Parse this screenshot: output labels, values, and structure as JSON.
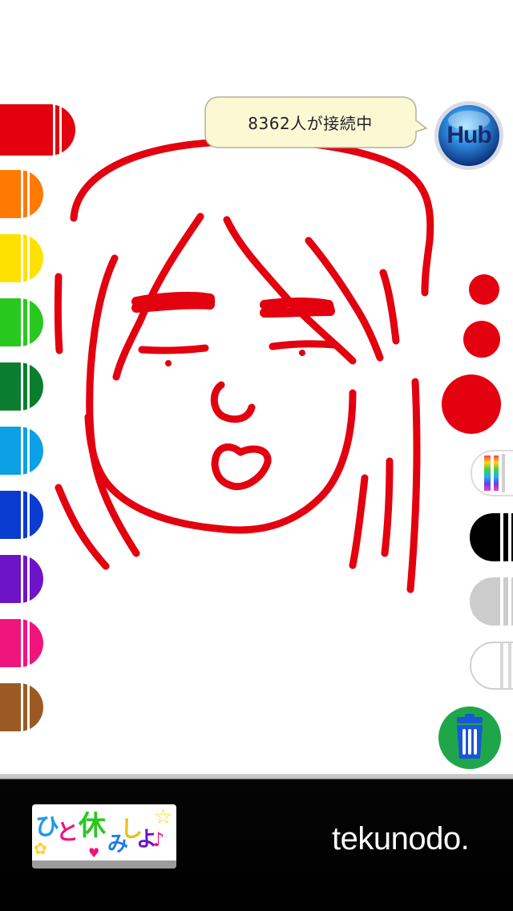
{
  "connection": {
    "count_text": "8362人が接続中"
  },
  "hub": {
    "label": "Hub"
  },
  "palette": {
    "colors": [
      {
        "name": "red",
        "hex": "#e3000f"
      },
      {
        "name": "orange",
        "hex": "#ff7a00"
      },
      {
        "name": "yellow",
        "hex": "#ffe100"
      },
      {
        "name": "light-green",
        "hex": "#28c81e"
      },
      {
        "name": "dark-green",
        "hex": "#0a7d2e"
      },
      {
        "name": "sky-blue",
        "hex": "#0ca0e6"
      },
      {
        "name": "blue",
        "hex": "#0a3cd2"
      },
      {
        "name": "purple",
        "hex": "#6e14c8"
      },
      {
        "name": "pink",
        "hex": "#f0147d"
      },
      {
        "name": "brown",
        "hex": "#9b5a23"
      }
    ],
    "selected": "red"
  },
  "tools": {
    "brush_sizes": [
      "small",
      "medium",
      "large"
    ],
    "special_crayons": [
      "rainbow",
      "black",
      "gray",
      "white-eraser"
    ],
    "trash": "trash-icon"
  },
  "footer": {
    "promo_text": "ひと休みしよ♪",
    "brand": "tekunodo."
  },
  "colors": {
    "stroke": "#e3000f",
    "bubble": "#fbf8d4",
    "footer": "#000000"
  }
}
